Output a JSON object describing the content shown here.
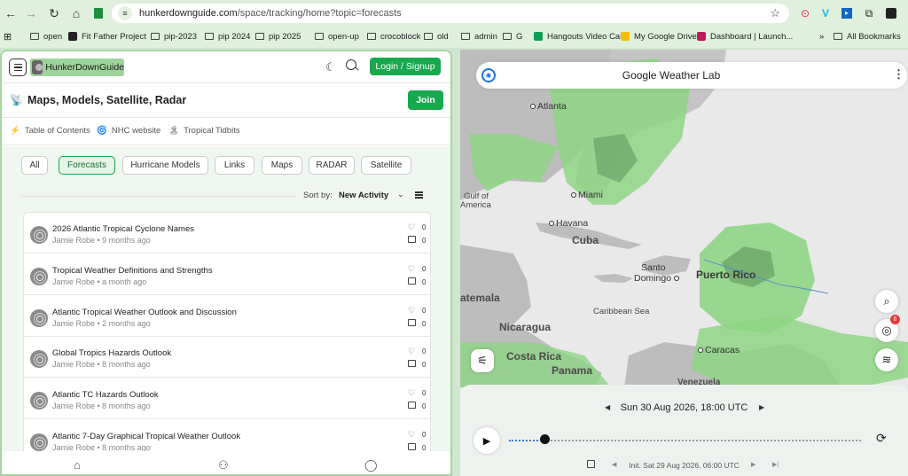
{
  "browser": {
    "url_host": "hunkerdownguide.com",
    "url_path": "/space/tracking/home?topic=forecasts",
    "bookmarks": [
      {
        "label": "open",
        "kind": "folder"
      },
      {
        "label": "Fit Father Project",
        "kind": "favicon",
        "color": "#222222"
      },
      {
        "label": "pip-2023",
        "kind": "folder"
      },
      {
        "label": "pip 2024",
        "kind": "folder"
      },
      {
        "label": "pip 2025",
        "kind": "folder"
      },
      {
        "label": "open-up",
        "kind": "folder"
      },
      {
        "label": "crocoblock",
        "kind": "folder"
      },
      {
        "label": "old",
        "kind": "folder"
      },
      {
        "label": "admin",
        "kind": "folder"
      },
      {
        "label": "G",
        "kind": "folder"
      },
      {
        "label": "Hangouts Video Call",
        "kind": "favicon",
        "color": "#0f9d58"
      },
      {
        "label": "My Google Drive",
        "kind": "favicon",
        "color": "#fbbc04"
      },
      {
        "label": "Dashboard | Launch...",
        "kind": "favicon",
        "color": "#c2185b"
      }
    ],
    "overflow_label": "»",
    "all_bookmarks": "All Bookmarks"
  },
  "site": {
    "logo_text": "HunkerDownGuide",
    "login_label": "Login / Signup",
    "section_title": "Maps, Models, Satellite, Radar",
    "join_label": "Join",
    "links": [
      {
        "icon": "⚡",
        "label": "Table of Contents"
      },
      {
        "icon": "🌀",
        "label": "NHC website"
      },
      {
        "icon": "🏝",
        "label": "Tropical Tidbits"
      }
    ],
    "filters": [
      "All",
      "Forecasts",
      "Hurricane Models",
      "Links",
      "Maps",
      "RADAR",
      "Satellite"
    ],
    "active_filter": "Forecasts",
    "sort_label": "Sort by:",
    "sort_value": "New Activity",
    "posts": [
      {
        "title": "2026 Atlantic Tropical Cyclone Names",
        "meta": "Jamie Robe • 9 months ago",
        "likes": "0",
        "comments": "0"
      },
      {
        "title": "Tropical Weather Definitions and Strengths",
        "meta": "Jamie Robe • a month ago",
        "likes": "0",
        "comments": "0"
      },
      {
        "title": "Atlantic Tropical Weather Outlook and Discussion",
        "meta": "Jamie Robe • 2 months ago",
        "likes": "0",
        "comments": "0"
      },
      {
        "title": "Global Tropics Hazards Outlook",
        "meta": "Jamie Robe • 8 months ago",
        "likes": "0",
        "comments": "0"
      },
      {
        "title": "Atlantic TC Hazards Outlook",
        "meta": "Jamie Robe • 8 months ago",
        "likes": "0",
        "comments": "0"
      },
      {
        "title": "Atlantic 7-Day Graphical Tropical Weather Outlook",
        "meta": "Jamie Robe • 8 months ago",
        "likes": "0",
        "comments": "0"
      }
    ]
  },
  "weather": {
    "title": "Google Weather Lab",
    "cities": [
      "Atlanta",
      "Miami",
      "Havana",
      "Caracas",
      "Santo",
      "Domingo",
      "Puerto Rico"
    ],
    "countries": [
      "Cuba",
      "Nicaragua",
      "Costa Rica",
      "Panama",
      "atemala",
      "Venezuela"
    ],
    "seas": [
      "Gulf of",
      "America",
      "Caribbean Sea"
    ],
    "badge_count": "6",
    "current_time": "Sun 30 Aug 2026, 18:00 UTC",
    "init_time": "Init. Sat 29 Aug 2026, 06:00 UTC",
    "progress_fraction": 0.1,
    "accent": "#1a73e8",
    "brand_green": "#18a84e"
  }
}
